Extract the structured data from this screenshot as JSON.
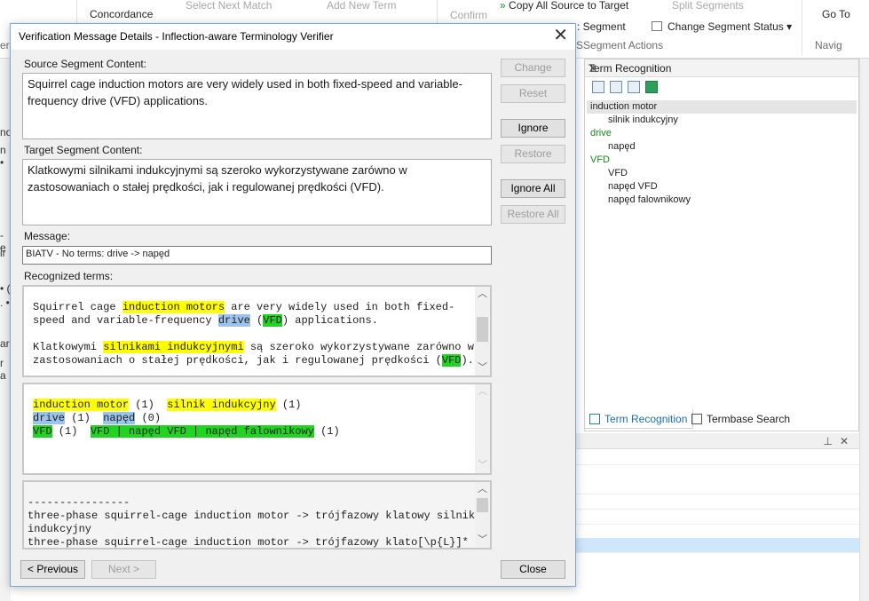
{
  "ribbon": {
    "concordance": "Concordance",
    "select_next_match": "Select Next Match",
    "add_new_term": "Add New Term",
    "confirm": "Confirm",
    "copy_all_source": "Copy All Source to Target",
    "split_segments": "Split Segments",
    "segment": "Segment",
    "change_segment_status": "Change Segment Status",
    "segment_actions": "Segment Actions",
    "go_to": "Go To",
    "navigation": "Navig",
    "left_clip": "er"
  },
  "term_recognition_panel": {
    "title": "Term Recognition",
    "items": [
      {
        "text": "induction motor",
        "level": 1,
        "selected": true,
        "green": false
      },
      {
        "text": "silnik indukcyjny",
        "level": 2,
        "selected": false,
        "green": false
      },
      {
        "text": "drive",
        "level": 1,
        "selected": false,
        "green": true
      },
      {
        "text": "napęd",
        "level": 2,
        "selected": false,
        "green": false
      },
      {
        "text": "VFD",
        "level": 1,
        "selected": false,
        "green": true
      },
      {
        "text": "VFD",
        "level": 2,
        "selected": false,
        "green": false
      },
      {
        "text": "napęd VFD",
        "level": 2,
        "selected": false,
        "green": false
      },
      {
        "text": "napęd falownikowy",
        "level": 2,
        "selected": false,
        "green": false
      }
    ],
    "tabs": {
      "term_recognition": "Term Recognition",
      "termbase_search": "Termbase Search"
    }
  },
  "dialog": {
    "title": "Verification Message Details - Inflection-aware Terminology Verifier",
    "source_label": "Source Segment Content:",
    "source_text": "Squirrel cage induction motors are very widely used in both fixed-speed and variable-frequency drive (VFD) applications.",
    "target_label": "Target Segment Content:",
    "target_text": "Klatkowymi silnikami indukcyjnymi są szeroko wykorzystywane zarówno w zastosowaniach o stałej prędkości, jak i regulowanej prędkości (VFD).",
    "message_label": "Message:",
    "message_text": "BIATV - No terms: drive -> napęd",
    "recognized_label": "Recognized terms:",
    "recognized": {
      "src1": [
        "Squirrel cage ",
        "induction motors",
        " are very widely used in both fixed-"
      ],
      "src2": [
        "speed and variable-frequency ",
        "drive",
        " (",
        "VFD",
        ") applications."
      ],
      "tgt1": [
        "Klatkowymi ",
        "silnikami indukcyjnymi",
        " są szeroko wykorzystywane zarówno w"
      ],
      "tgt2": [
        "zastosowaniach o stałej prędkości, jak i regulowanej prędkości (",
        "VFD",
        ")."
      ]
    },
    "pairs": {
      "l1": [
        "induction motor",
        " (1)  ",
        "silnik indukcyjny",
        " (1)"
      ],
      "l2": [
        "drive",
        " (1)  ",
        "napęd",
        " (0)"
      ],
      "l3": [
        "VFD",
        " (1)  ",
        "VFD | napęd VFD | napęd falownikowy",
        " (1)"
      ]
    },
    "log_lines": [
      "----------------",
      "three-phase squirrel-cage induction motor -> trójfazowy klatowy silnik",
      "indukcyjny",
      "three-phase squirrel-cage induction motor -> trójfazowy klato[\\p{L}]*"
    ],
    "buttons": {
      "change": "Change",
      "reset": "Reset",
      "ignore": "Ignore",
      "restore": "Restore",
      "ignore_all": "Ignore All",
      "restore_all": "Restore All",
      "previous": "< Previous",
      "next": "Next >",
      "close": "Close"
    }
  }
}
